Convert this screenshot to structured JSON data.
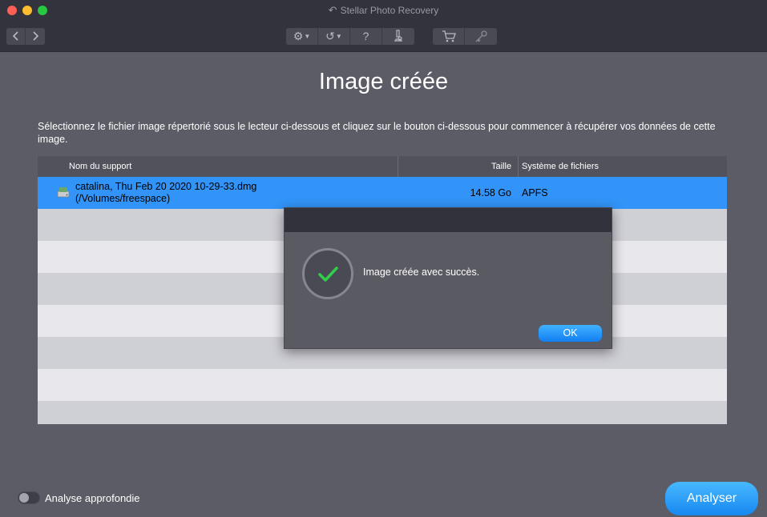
{
  "window": {
    "title": "Stellar Photo Recovery"
  },
  "toolbar": {
    "back_icon": "chevron-left",
    "forward_icon": "chevron-right",
    "settings_icon": "gear",
    "history_icon": "clock-back",
    "help_label": "?",
    "scan_icon": "microscope",
    "cart_icon": "cart",
    "key_icon": "key"
  },
  "main": {
    "title": "Image créée",
    "instructions": "Sélectionnez le fichier image répertorié sous le lecteur ci-dessous et cliquez sur le bouton ci-dessous pour commencer à récupérer vos données de cette image."
  },
  "table": {
    "columns": [
      "Nom du support",
      "Taille",
      "Système de fichiers"
    ],
    "rows": [
      {
        "name_line1": "catalina, Thu Feb 20 2020 10-29-33.dmg",
        "name_line2": "(/Volumes/freespace)",
        "size": "14.58 Go",
        "filesystem": "APFS",
        "selected": true
      }
    ]
  },
  "dialog": {
    "message": "Image créée avec succès.",
    "ok_label": "OK",
    "icon": "checkmark"
  },
  "footer": {
    "deep_scan_label": "Analyse approfondie",
    "deep_scan_enabled": false,
    "analyze_label": "Analyser"
  },
  "colors": {
    "accent": "#3294f8",
    "success": "#2fcf4a",
    "background": "#5c5c66"
  }
}
